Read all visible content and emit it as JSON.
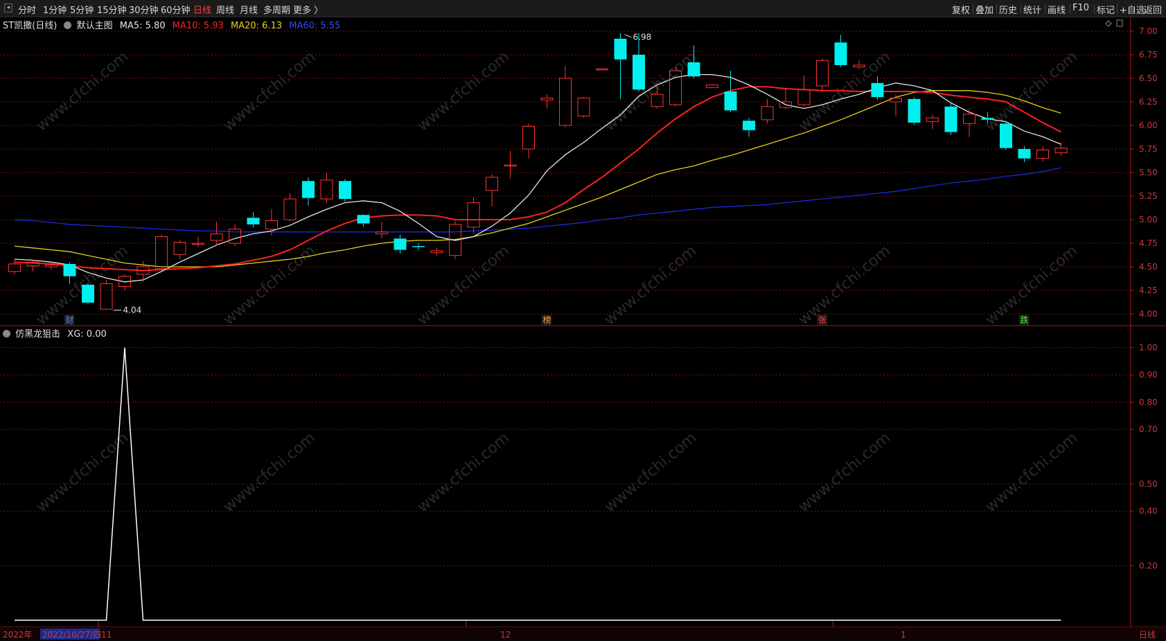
{
  "toolbar": {
    "periods": [
      "分时",
      "1分钟",
      "5分钟",
      "15分钟",
      "30分钟",
      "60分钟",
      "日线",
      "周线",
      "月线",
      "多周期",
      "更多 〉"
    ],
    "active_period": "日线",
    "tools": [
      "复权",
      "叠加",
      "历史",
      "统计",
      "画线",
      "F10",
      "标记",
      "+自选",
      "返回"
    ]
  },
  "main_legend": {
    "stock": "ST凯撒(日线)",
    "template": "默认主图",
    "ma5": "MA5: 5.80",
    "ma10": "MA10: 5.93",
    "ma20": "MA20: 6.13",
    "ma60": "MA60: 5.55"
  },
  "indicator_legend": {
    "name": "仿黑龙狙击",
    "value": "XG: 0.00"
  },
  "colors": {
    "up": "#ff3333",
    "down": "#00f0f0",
    "ma5": "#e8e8e8",
    "ma10": "#ff2020",
    "ma20": "#e6d21a",
    "ma60": "#1a2ad8",
    "xg": "#ffffff",
    "axis_text": "#c93b3b",
    "grid": "#7a1212"
  },
  "bottom_axis": {
    "year": "2022年",
    "cursor_date": "2022/10/27/四",
    "month_labels": [
      "11",
      "12",
      "1"
    ],
    "period_label": "日线"
  },
  "watermark": "www.cfchi.com",
  "chart_data": [
    {
      "type": "candlestick",
      "ylim": [
        4.0,
        7.0
      ],
      "y_ticks": [
        "4.00",
        "4.25",
        "4.50",
        "4.75",
        "5.00",
        "5.25",
        "5.50",
        "5.75",
        "6.00",
        "6.25",
        "6.50",
        "6.75",
        "7.00"
      ],
      "annotations": {
        "high_label": "6.98",
        "low_label": "4.04"
      },
      "event_markers": [
        {
          "text": "财",
          "index": 3,
          "color": "#4a8fff"
        },
        {
          "text": "榜",
          "index": 29,
          "color": "#ffa040"
        },
        {
          "text": "张",
          "index": 44,
          "color": "#ff4040"
        },
        {
          "text": "跌",
          "index": 55,
          "color": "#40ff40"
        }
      ],
      "candles": [
        [
          4.45,
          4.53,
          4.58,
          4.42
        ],
        [
          4.51,
          4.55,
          4.58,
          4.45
        ],
        [
          4.5,
          4.52,
          4.55,
          4.47
        ],
        [
          4.53,
          4.4,
          4.55,
          4.32
        ],
        [
          4.31,
          4.12,
          4.33,
          4.1
        ],
        [
          4.05,
          4.32,
          4.36,
          4.04
        ],
        [
          4.29,
          4.4,
          4.42,
          4.25
        ],
        [
          4.42,
          4.5,
          4.56,
          4.34
        ],
        [
          4.48,
          4.82,
          4.84,
          4.46
        ],
        [
          4.63,
          4.76,
          4.78,
          4.58
        ],
        [
          4.74,
          4.75,
          4.82,
          4.71
        ],
        [
          4.78,
          4.85,
          4.98,
          4.72
        ],
        [
          4.75,
          4.9,
          4.95,
          4.72
        ],
        [
          5.02,
          4.95,
          5.08,
          4.92
        ],
        [
          4.9,
          4.99,
          5.11,
          4.83
        ],
        [
          5.0,
          5.22,
          5.28,
          4.98
        ],
        [
          5.41,
          5.23,
          5.45,
          5.15
        ],
        [
          5.22,
          5.42,
          5.5,
          5.18
        ],
        [
          5.41,
          5.22,
          5.43,
          5.19
        ],
        [
          5.05,
          4.96,
          5.06,
          4.93
        ],
        [
          4.85,
          4.87,
          4.98,
          4.8
        ],
        [
          4.8,
          4.68,
          4.84,
          4.64
        ],
        [
          4.72,
          4.71,
          4.75,
          4.68
        ],
        [
          4.65,
          4.67,
          4.7,
          4.62
        ],
        [
          4.62,
          4.95,
          4.99,
          4.58
        ],
        [
          4.92,
          5.18,
          5.24,
          4.85
        ],
        [
          5.31,
          5.45,
          5.48,
          5.14
        ],
        [
          5.58,
          5.58,
          5.73,
          5.44
        ],
        [
          5.75,
          5.99,
          6.02,
          5.65
        ],
        [
          6.27,
          6.29,
          6.33,
          6.18
        ],
        [
          6.0,
          6.5,
          6.63,
          5.98
        ],
        [
          6.1,
          6.29,
          6.3,
          6.08
        ],
        [
          6.6,
          6.6,
          6.6,
          6.6
        ],
        [
          6.92,
          6.7,
          6.98,
          6.28
        ],
        [
          6.75,
          6.38,
          6.98,
          6.36
        ],
        [
          6.2,
          6.33,
          6.45,
          6.18
        ],
        [
          6.22,
          6.58,
          6.62,
          6.2
        ],
        [
          6.67,
          6.52,
          6.85,
          6.5
        ],
        [
          6.4,
          6.43,
          6.43,
          6.4
        ],
        [
          6.36,
          6.16,
          6.58,
          6.14
        ],
        [
          6.05,
          5.95,
          6.08,
          5.88
        ],
        [
          6.06,
          6.2,
          6.28,
          6.02
        ],
        [
          6.19,
          6.25,
          6.4,
          6.17
        ],
        [
          6.22,
          6.38,
          6.53,
          6.2
        ],
        [
          6.42,
          6.69,
          6.71,
          6.36
        ],
        [
          6.88,
          6.64,
          6.96,
          6.62
        ],
        [
          6.62,
          6.64,
          6.69,
          6.6
        ],
        [
          6.45,
          6.3,
          6.52,
          6.27
        ],
        [
          6.25,
          6.29,
          6.33,
          6.1
        ],
        [
          6.28,
          6.03,
          6.3,
          6.01
        ],
        [
          6.04,
          6.08,
          6.11,
          5.96
        ],
        [
          6.2,
          5.93,
          6.25,
          5.9
        ],
        [
          6.02,
          6.12,
          6.18,
          5.88
        ],
        [
          6.08,
          6.06,
          6.14,
          6.02
        ],
        [
          6.02,
          5.76,
          6.05,
          5.74
        ],
        [
          5.75,
          5.65,
          5.78,
          5.61
        ],
        [
          5.65,
          5.74,
          5.78,
          5.62
        ],
        [
          5.71,
          5.76,
          5.82,
          5.68
        ]
      ],
      "ma5": [
        4.58,
        4.57,
        4.55,
        4.52,
        4.44,
        4.38,
        4.34,
        4.36,
        4.45,
        4.55,
        4.64,
        4.73,
        4.8,
        4.85,
        4.88,
        4.94,
        5.03,
        5.11,
        5.18,
        5.2,
        5.18,
        5.09,
        4.96,
        4.82,
        4.78,
        4.82,
        4.93,
        5.07,
        5.26,
        5.52,
        5.69,
        5.82,
        5.97,
        6.11,
        6.31,
        6.43,
        6.51,
        6.54,
        6.54,
        6.51,
        6.43,
        6.33,
        6.22,
        6.18,
        6.22,
        6.28,
        6.33,
        6.4,
        6.45,
        6.42,
        6.37,
        6.24,
        6.14,
        6.07,
        6.04,
        5.94,
        5.88,
        5.8
      ],
      "ma10": [
        4.55,
        4.54,
        4.53,
        4.51,
        4.49,
        4.48,
        4.47,
        4.46,
        4.47,
        4.48,
        4.49,
        4.51,
        4.53,
        4.57,
        4.61,
        4.68,
        4.78,
        4.88,
        4.96,
        5.02,
        5.04,
        5.05,
        5.05,
        5.04,
        5.0,
        5.0,
        5.0,
        5.0,
        5.03,
        5.08,
        5.18,
        5.32,
        5.45,
        5.6,
        5.75,
        5.92,
        6.07,
        6.2,
        6.3,
        6.37,
        6.41,
        6.41,
        6.39,
        6.38,
        6.37,
        6.37,
        6.36,
        6.36,
        6.36,
        6.36,
        6.35,
        6.32,
        6.3,
        6.28,
        6.25,
        6.14,
        6.03,
        5.93
      ],
      "ma20": [
        4.72,
        4.7,
        4.68,
        4.66,
        4.62,
        4.58,
        4.54,
        4.52,
        4.5,
        4.5,
        4.5,
        4.5,
        4.52,
        4.54,
        4.56,
        4.58,
        4.61,
        4.65,
        4.68,
        4.72,
        4.75,
        4.77,
        4.78,
        4.78,
        4.79,
        4.82,
        4.86,
        4.91,
        4.96,
        5.03,
        5.1,
        5.17,
        5.24,
        5.32,
        5.4,
        5.48,
        5.53,
        5.57,
        5.63,
        5.68,
        5.74,
        5.8,
        5.86,
        5.92,
        5.99,
        6.06,
        6.14,
        6.22,
        6.3,
        6.35,
        6.37,
        6.37,
        6.37,
        6.35,
        6.32,
        6.26,
        6.19,
        6.13
      ],
      "ma60": [
        5.0,
        4.99,
        4.97,
        4.95,
        4.94,
        4.93,
        4.92,
        4.91,
        4.9,
        4.89,
        4.88,
        4.88,
        4.87,
        4.87,
        4.87,
        4.87,
        4.87,
        4.87,
        4.87,
        4.87,
        4.87,
        4.87,
        4.87,
        4.87,
        4.87,
        4.88,
        4.89,
        4.9,
        4.91,
        4.93,
        4.95,
        4.97,
        5.0,
        5.02,
        5.05,
        5.07,
        5.09,
        5.11,
        5.13,
        5.14,
        5.15,
        5.16,
        5.18,
        5.2,
        5.22,
        5.24,
        5.26,
        5.28,
        5.3,
        5.33,
        5.36,
        5.39,
        5.41,
        5.43,
        5.46,
        5.48,
        5.51,
        5.55
      ]
    },
    {
      "type": "line",
      "name": "XG",
      "ylim": [
        0.0,
        1.05
      ],
      "y_ticks": [
        "0.20",
        "0.40",
        "0.50",
        "0.70",
        "0.80",
        "0.90",
        "1.00"
      ],
      "values": [
        0,
        0,
        0,
        0,
        0,
        0,
        1,
        0,
        0,
        0,
        0,
        0,
        0,
        0,
        0,
        0,
        0,
        0,
        0,
        0,
        0,
        0,
        0,
        0,
        0,
        0,
        0,
        0,
        0,
        0,
        0,
        0,
        0,
        0,
        0,
        0,
        0,
        0,
        0,
        0,
        0,
        0,
        0,
        0,
        0,
        0,
        0,
        0,
        0,
        0,
        0,
        0,
        0,
        0,
        0,
        0,
        0,
        0
      ]
    }
  ]
}
